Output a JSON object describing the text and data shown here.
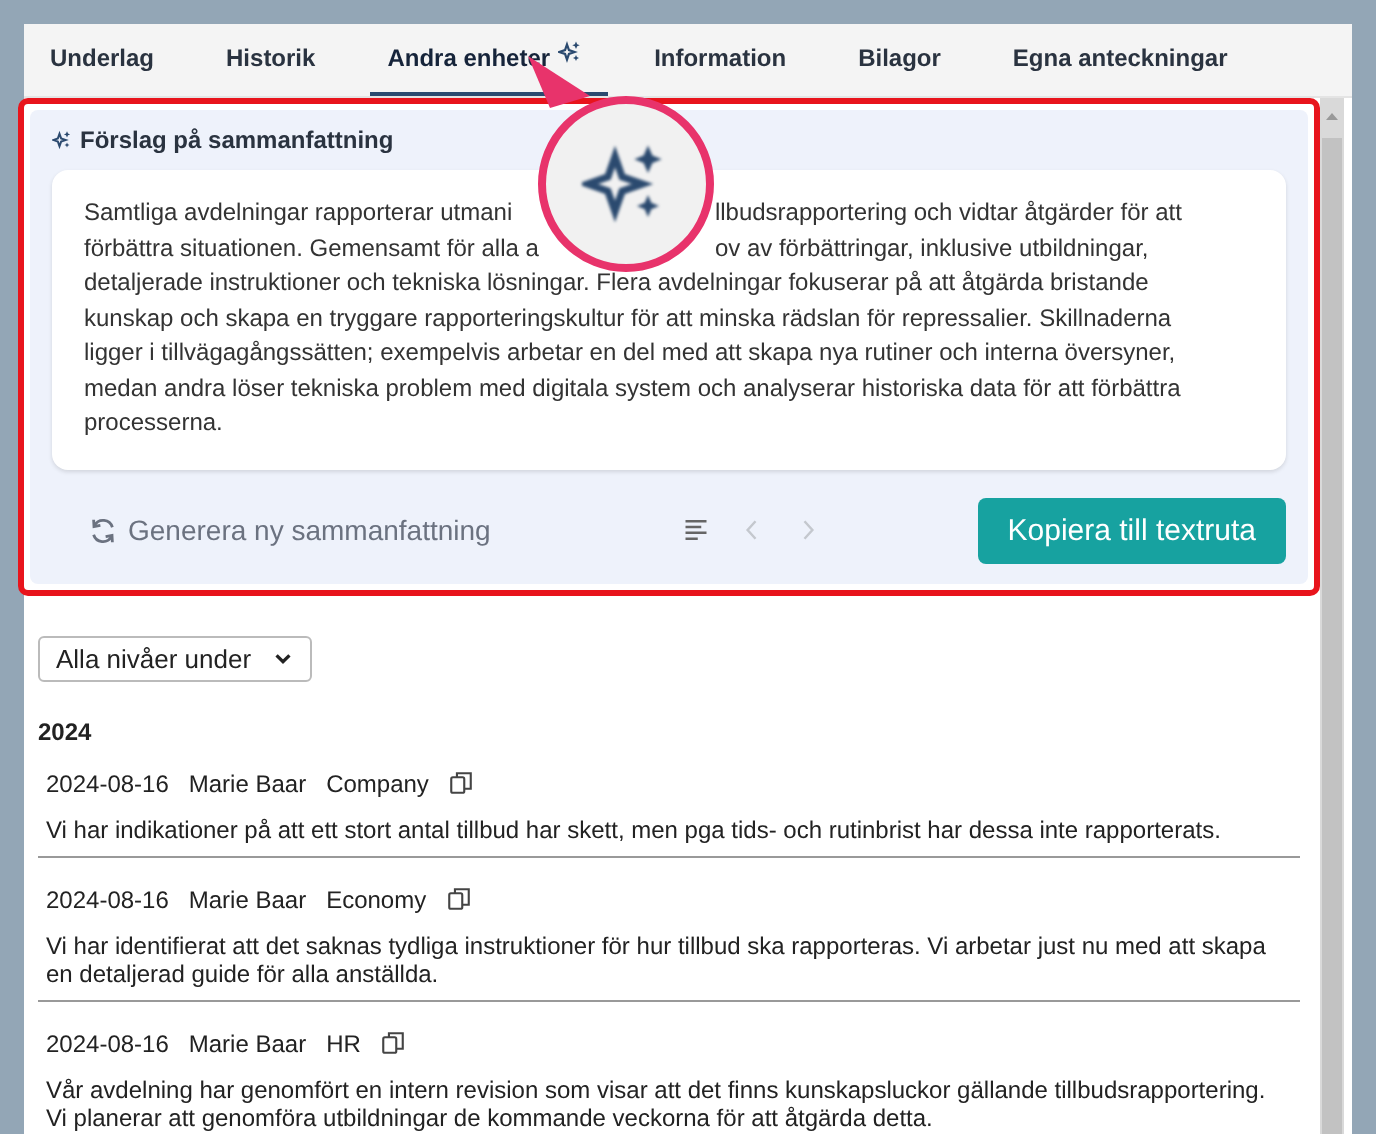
{
  "tabs": [
    {
      "label": "Underlag",
      "selected": false,
      "ai": false
    },
    {
      "label": "Historik",
      "selected": false,
      "ai": false
    },
    {
      "label": "Andra enheter",
      "selected": true,
      "ai": true
    },
    {
      "label": "Information",
      "selected": false,
      "ai": false
    },
    {
      "label": "Bilagor",
      "selected": false,
      "ai": false
    },
    {
      "label": "Egna anteckningar",
      "selected": false,
      "ai": false
    }
  ],
  "summary": {
    "title": "Förslag på sammanfattning",
    "covered_lines": [
      {
        "left": "Samtliga avdelningar rapporterar utmani",
        "right": "llbudsrapportering och vidtar åtgärder för att"
      },
      {
        "left": "förbättra situationen. Gemensamt för alla a",
        "right": "ov av förbättringar, inklusive utbildningar,"
      }
    ],
    "text": "detaljerade instruktioner och tekniska lösningar. Flera avdelningar fokuserar på att åtgärda bristande kunskap och skapa en tryggare rapporteringskultur för att minska rädslan för repressalier. Skillnaderna ligger i tillvägagångssätten; exempelvis arbetar en del med att skapa nya rutiner och interna översyner, medan andra löser tekniska problem med digitala system och analyserar historiska data för att förbättra processerna.",
    "regenerate": "Generera ny sammanfattning",
    "nav": [
      {
        "kind": "prev",
        "disabled": true
      },
      {
        "kind": "next",
        "disabled": true
      }
    ],
    "copy_button": "Kopiera till textruta"
  },
  "filter": {
    "value": "Alla nivåer under"
  },
  "year": "2024",
  "entries": [
    {
      "date": "2024-08-16",
      "author": "Marie Baar",
      "unit": "Company",
      "text": "Vi har indikationer på att ett stort antal tillbud har skett, men pga tids- och rutinbrist har dessa inte rapporterats."
    },
    {
      "date": "2024-08-16",
      "author": "Marie Baar",
      "unit": "Economy",
      "text": "Vi har identifierat att det saknas tydliga instruktioner för hur tillbud ska rapporteras. Vi arbetar just nu med att skapa en detaljerad guide för alla anställda."
    },
    {
      "date": "2024-08-16",
      "author": "Marie Baar",
      "unit": "HR",
      "text": "Vår avdelning har genomfört en intern revision som visar att det finns kunskapsluckor gällande tillbudsrapportering. Vi planerar att genomföra utbildningar de kommande veckorna för att åtgärda detta."
    }
  ]
}
